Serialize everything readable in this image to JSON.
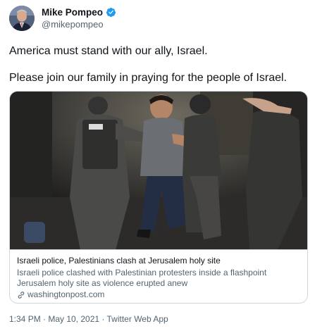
{
  "author": {
    "name": "Mike Pompeo",
    "handle": "@mikepompeo"
  },
  "tweet": {
    "line1": "America must stand with our ally, Israel.",
    "line2": "Please join our family in praying for the people of Israel."
  },
  "card": {
    "title": "Israeli police, Palestinians clash at Jerusalem holy site",
    "description": "Israeli police clashed with Palestinian protesters inside a flashpoint Jerusalem holy site as violence erupted anew",
    "domain": "washingtonpost.com"
  },
  "footer": {
    "timestamp": "1:34 PM · May 10, 2021 · Twitter Web App"
  },
  "colors": {
    "verified_blue": "#1d9bf0",
    "secondary_text": "#536471",
    "border": "#cfd9de"
  }
}
